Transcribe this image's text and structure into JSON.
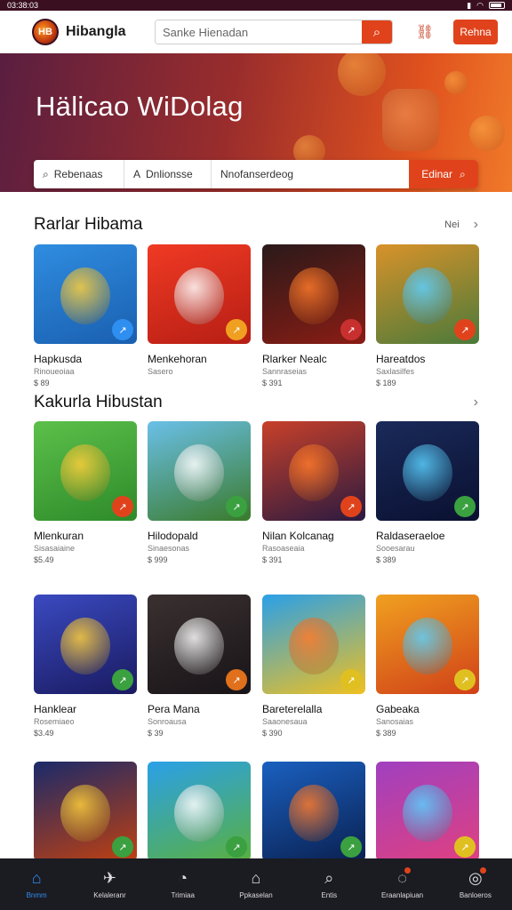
{
  "status": {
    "time": "03:38:03",
    "icons": [
      "signal-icon",
      "wifi-icon",
      "battery-icon"
    ]
  },
  "topbar": {
    "brand": "Hibangla",
    "search_placeholder": "Sanke Hienadan",
    "signin_label": "Rehna"
  },
  "hero": {
    "title": "Hälicao WiDolag",
    "filters": [
      "Rebenaas",
      "Dnlionsse",
      "Nnofanserdeog"
    ],
    "filter_button": "Edinar",
    "accent": "#e0431c"
  },
  "sections": [
    {
      "title": "Rarlar Hibama",
      "action_label": "Nei",
      "cards": [
        {
          "title": "Hapkusda",
          "sub": "Rinoueoiaa",
          "price": "$ 89",
          "bg": [
            "#2f8de0",
            "#1a5fb0"
          ],
          "badge": "#2f8ff0"
        },
        {
          "title": "Menkehoran",
          "sub": "Sasero",
          "price": "",
          "bg": [
            "#f03a24",
            "#b61e14"
          ],
          "badge": "#f0a020"
        },
        {
          "title": "Rlarker Nealc",
          "sub": "Sannraseias",
          "price": "$ 391",
          "bg": [
            "#2a1a1a",
            "#8a1c14"
          ],
          "badge": "#c83030"
        },
        {
          "title": "Hareatdos",
          "sub": "Saxlasilfes",
          "price": "$ 189",
          "bg": [
            "#d8922a",
            "#4a7a3a"
          ],
          "badge": "#e0431c"
        }
      ]
    },
    {
      "title": "Kakurla Hibustan",
      "action_label": "",
      "cards": [
        {
          "title": "Mlenkuran",
          "sub": "Sisasaiaine",
          "price": "$5.49",
          "bg": [
            "#5cc04a",
            "#2e8a2a"
          ],
          "badge": "#e0431c"
        },
        {
          "title": "Hilodopald",
          "sub": "Sinaesonas",
          "price": "$ 999",
          "bg": [
            "#6ac0e8",
            "#3a7a2a"
          ],
          "badge": "#3aa040"
        },
        {
          "title": "Nilan Kolcanag",
          "sub": "Rasoaseaia",
          "price": "$ 391",
          "bg": [
            "#c8402a",
            "#2a1a40"
          ],
          "badge": "#e0431c"
        },
        {
          "title": "Raldaseraeloe",
          "sub": "Sooesarau",
          "price": "$ 389",
          "bg": [
            "#1a2a5a",
            "#0a1030"
          ],
          "badge": "#3aa040"
        }
      ]
    },
    {
      "title": "",
      "action_label": "",
      "cards": [
        {
          "title": "Hanklear",
          "sub": "Rosemiaeo",
          "price": "$3.49",
          "bg": [
            "#3a4ac0",
            "#1a1a60"
          ],
          "badge": "#3aa040"
        },
        {
          "title": "Pera Mana",
          "sub": "Sonroausa",
          "price": "$ 39",
          "bg": [
            "#3a3030",
            "#181418"
          ],
          "badge": "#e0701c"
        },
        {
          "title": "Bareterelalla",
          "sub": "Saaonesaua",
          "price": "$ 390",
          "bg": [
            "#2aa0e8",
            "#f0c020"
          ],
          "badge": "#e0c020"
        },
        {
          "title": "Gabeaka",
          "sub": "Sanosaias",
          "price": "$ 389",
          "bg": [
            "#f0a020",
            "#d04018"
          ],
          "badge": "#e0c020"
        }
      ]
    },
    {
      "title": "",
      "action_label": "",
      "cards": [
        {
          "title": "",
          "sub": "",
          "price": "",
          "bg": [
            "#1a2a6a",
            "#c04010"
          ],
          "badge": "#3aa040"
        },
        {
          "title": "",
          "sub": "",
          "price": "",
          "bg": [
            "#2aa0e8",
            "#5ab040"
          ],
          "badge": "#3aa040"
        },
        {
          "title": "",
          "sub": "",
          "price": "",
          "bg": [
            "#1a60c0",
            "#0a2050"
          ],
          "badge": "#3aa040"
        },
        {
          "title": "",
          "sub": "",
          "price": "",
          "bg": [
            "#a040c0",
            "#e04080"
          ],
          "badge": "#e0c020"
        }
      ]
    }
  ],
  "nav": [
    {
      "label": "Bnmm",
      "icon": "home-icon",
      "active": true
    },
    {
      "label": "Kelaleranr",
      "icon": "gamepad-icon",
      "active": false
    },
    {
      "label": "Trimiaa",
      "icon": "clock-icon",
      "active": false
    },
    {
      "label": "Ppkaselan",
      "icon": "library-icon",
      "active": false
    },
    {
      "label": "Entis",
      "icon": "search-icon",
      "active": false
    },
    {
      "label": "Eraanlapiuan",
      "icon": "chat-icon",
      "active": false
    },
    {
      "label": "Banloeros",
      "icon": "profile-icon",
      "active": false
    }
  ]
}
